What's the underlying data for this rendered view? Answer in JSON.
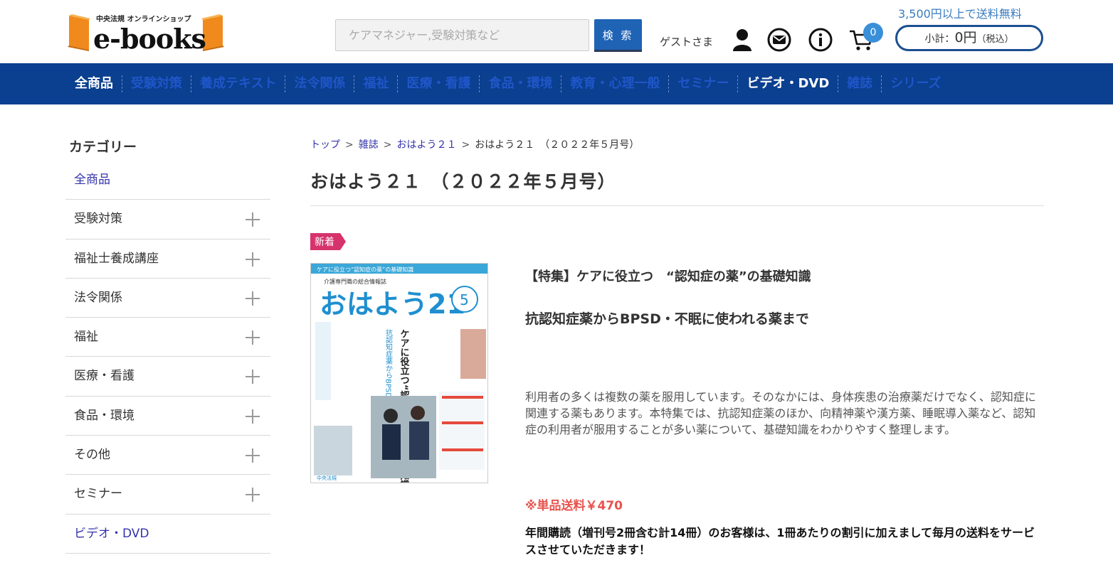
{
  "header": {
    "logo_sub": "中央法規 オンラインショップ",
    "logo_main": "e-books",
    "search_placeholder": "ケアマネジャー,受験対策など",
    "search_button": "検 索",
    "guest_label": "ゲストさま",
    "cart_count": "0",
    "free_shipping": "3,500円以上で送料無料",
    "subtotal_label": "小計：",
    "subtotal_amount": "0円",
    "subtotal_tax": "（税込）"
  },
  "nav": [
    {
      "label": "全商品",
      "active": true
    },
    {
      "label": "受験対策"
    },
    {
      "label": "養成テキスト"
    },
    {
      "label": "法令関係"
    },
    {
      "label": "福祉"
    },
    {
      "label": "医療・看護"
    },
    {
      "label": "食品・環境"
    },
    {
      "label": "教育・心理一般"
    },
    {
      "label": "セミナー"
    },
    {
      "label": "ビデオ・DVD",
      "active": true
    },
    {
      "label": "雑誌"
    },
    {
      "label": "シリーズ"
    }
  ],
  "sidebar": {
    "title": "カテゴリー",
    "items": [
      {
        "label": "全商品"
      },
      {
        "label": "受験対策"
      },
      {
        "label": "福祉士養成講座"
      },
      {
        "label": "法令関係"
      },
      {
        "label": "福祉"
      },
      {
        "label": "医療・看護"
      },
      {
        "label": "食品・環境"
      },
      {
        "label": "その他"
      },
      {
        "label": "セミナー"
      },
      {
        "label": "ビデオ・DVD"
      }
    ]
  },
  "breadcrumb": {
    "items": [
      "トップ",
      "雑誌",
      "おはよう２１",
      "おはよう２１　（２０２２年５月号）"
    ],
    "sep": ">"
  },
  "product": {
    "title": "おはよう２１　（２０２２年５月号）",
    "badge": "新着",
    "feature": "【特集】ケアに役立つ　“認知症の薬”の基礎知識",
    "subtitle": "抗認知症薬からBPSD・不眠に使われる薬まで",
    "description": "利用者の多くは複数の薬を服用しています。そのなかには、身体疾患の治療薬だけでなく、認知症に関連する薬もあります。本特集では、抗認知症薬のほか、向精神薬や漢方薬、睡眠導入薬など、認知症の利用者が服用することが多い薬について、基礎知識をわかりやすく整理します。",
    "shipping_note": "※単品送料￥470",
    "annual_note": "年間購読（増刊号2冊含む計14冊）のお客様は、1冊あたりの割引に加えまして毎月の送料をサービスさせていただきます！"
  },
  "cover": {
    "banner": "ケアに役立つ“認知症の薬”の基礎知識",
    "kicker": "介護専門職の総合情報誌",
    "masthead": "おはよう21",
    "issue_number": "5",
    "headline": "ケアに役立つ“認知症の薬”の基礎知識",
    "sub_headline": "抗認知症薬からBPSD・不眠に使われる薬まで",
    "publisher": "中央法規"
  },
  "colors": {
    "nav_bg": "#0b3f8f",
    "nav_link": "#1f56c8",
    "accent_blue": "#1f63b5",
    "badge": "#d6336c",
    "shipping_red": "#e8534d",
    "logo_orange": "#f08a1c"
  }
}
